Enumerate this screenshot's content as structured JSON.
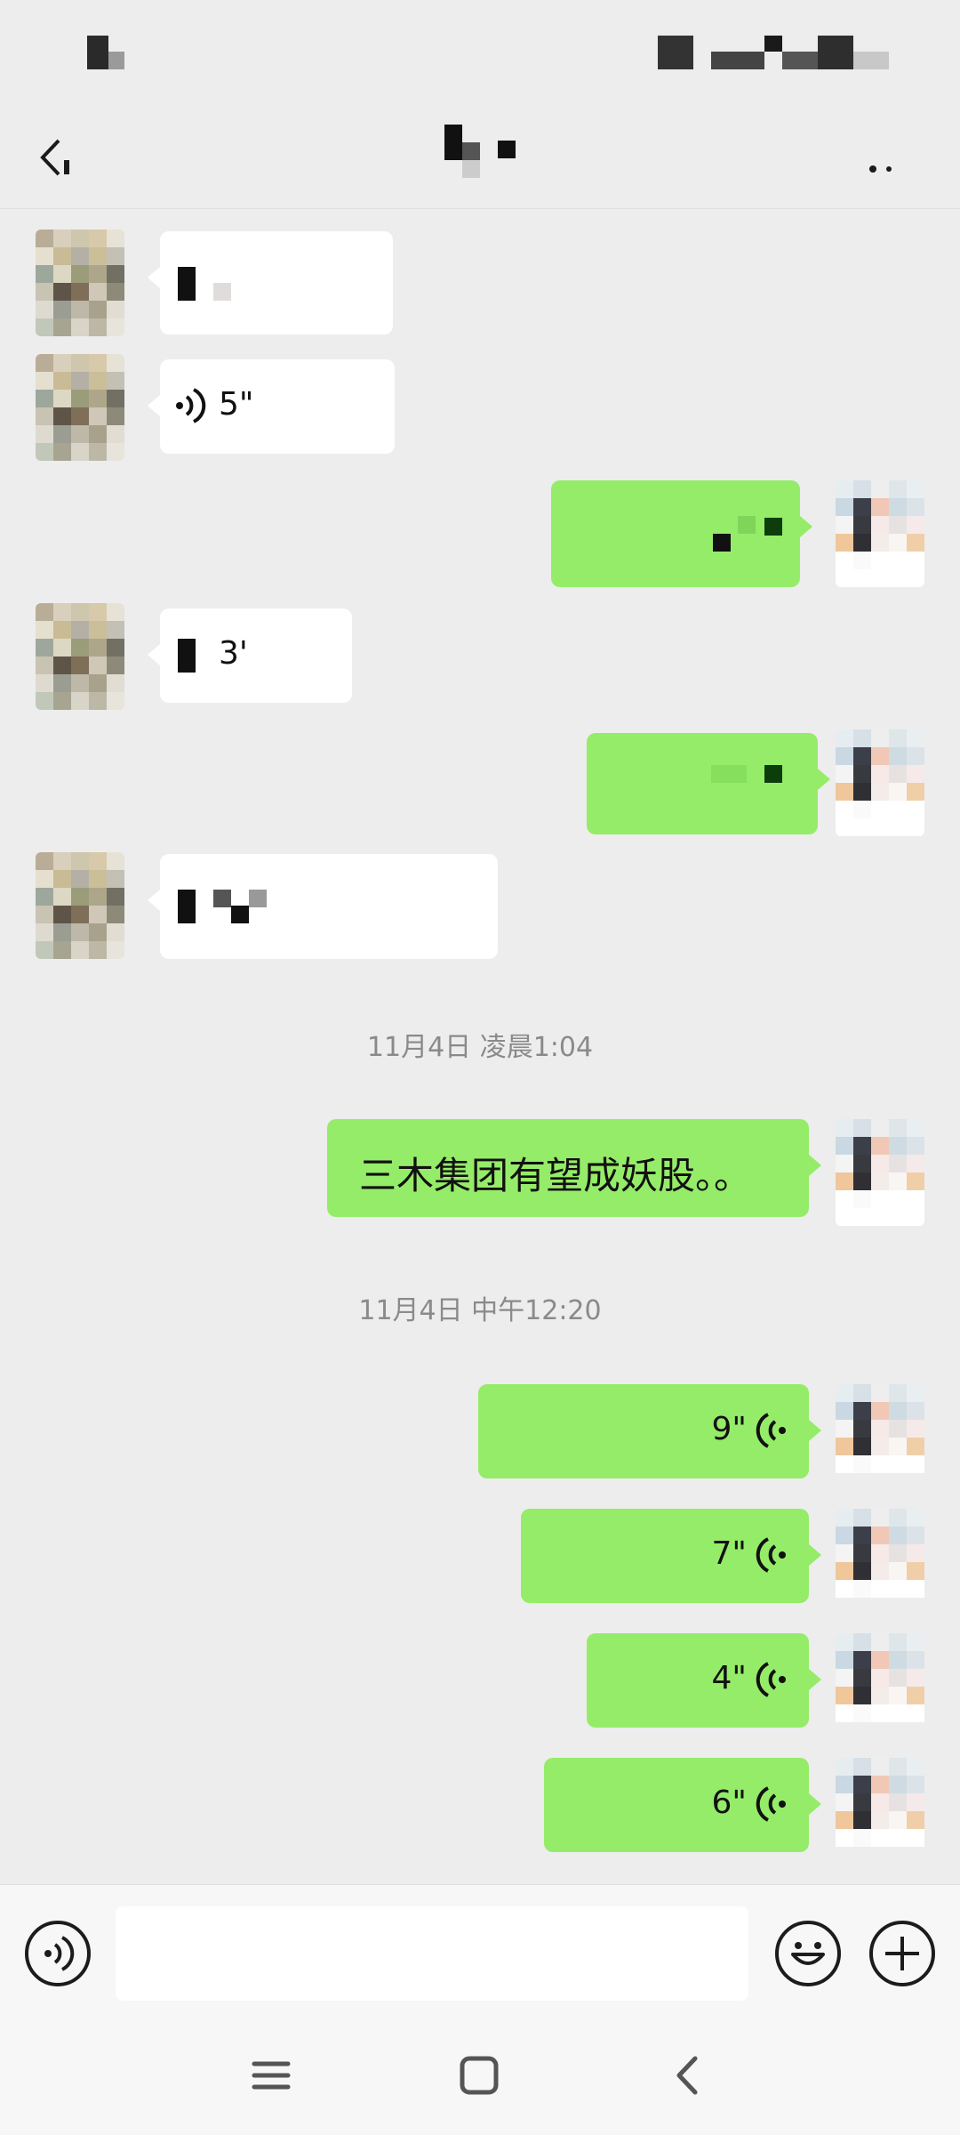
{
  "chat": {
    "messages": [
      {
        "type": "voice",
        "direction": "in",
        "duration": "5\""
      },
      {
        "type": "voice",
        "direction": "in",
        "duration": "3'"
      },
      {
        "type": "timestamp",
        "text": "11月4日 凌晨1:04"
      },
      {
        "type": "text",
        "direction": "out",
        "text": "三木集团有望成妖股。。"
      },
      {
        "type": "timestamp",
        "text": "11月4日 中午12:20"
      },
      {
        "type": "voice",
        "direction": "out",
        "duration": "9\""
      },
      {
        "type": "voice",
        "direction": "out",
        "duration": "7\""
      },
      {
        "type": "voice",
        "direction": "out",
        "duration": "4\""
      },
      {
        "type": "voice",
        "direction": "out",
        "duration": "6\""
      }
    ]
  },
  "input": {
    "value": ""
  },
  "icons": {
    "back": "chevron-left-icon",
    "more": "more-icon",
    "voice_mode": "voice-mode-icon",
    "emoji": "emoji-icon",
    "add": "plus-icon",
    "nav_menu": "menu-icon",
    "nav_home": "home-icon",
    "nav_back": "back-icon"
  },
  "colors": {
    "background": "#ededed",
    "outgoing_bubble": "#95ec69",
    "incoming_bubble": "#ffffff",
    "timestamp": "#8a8a8a"
  }
}
